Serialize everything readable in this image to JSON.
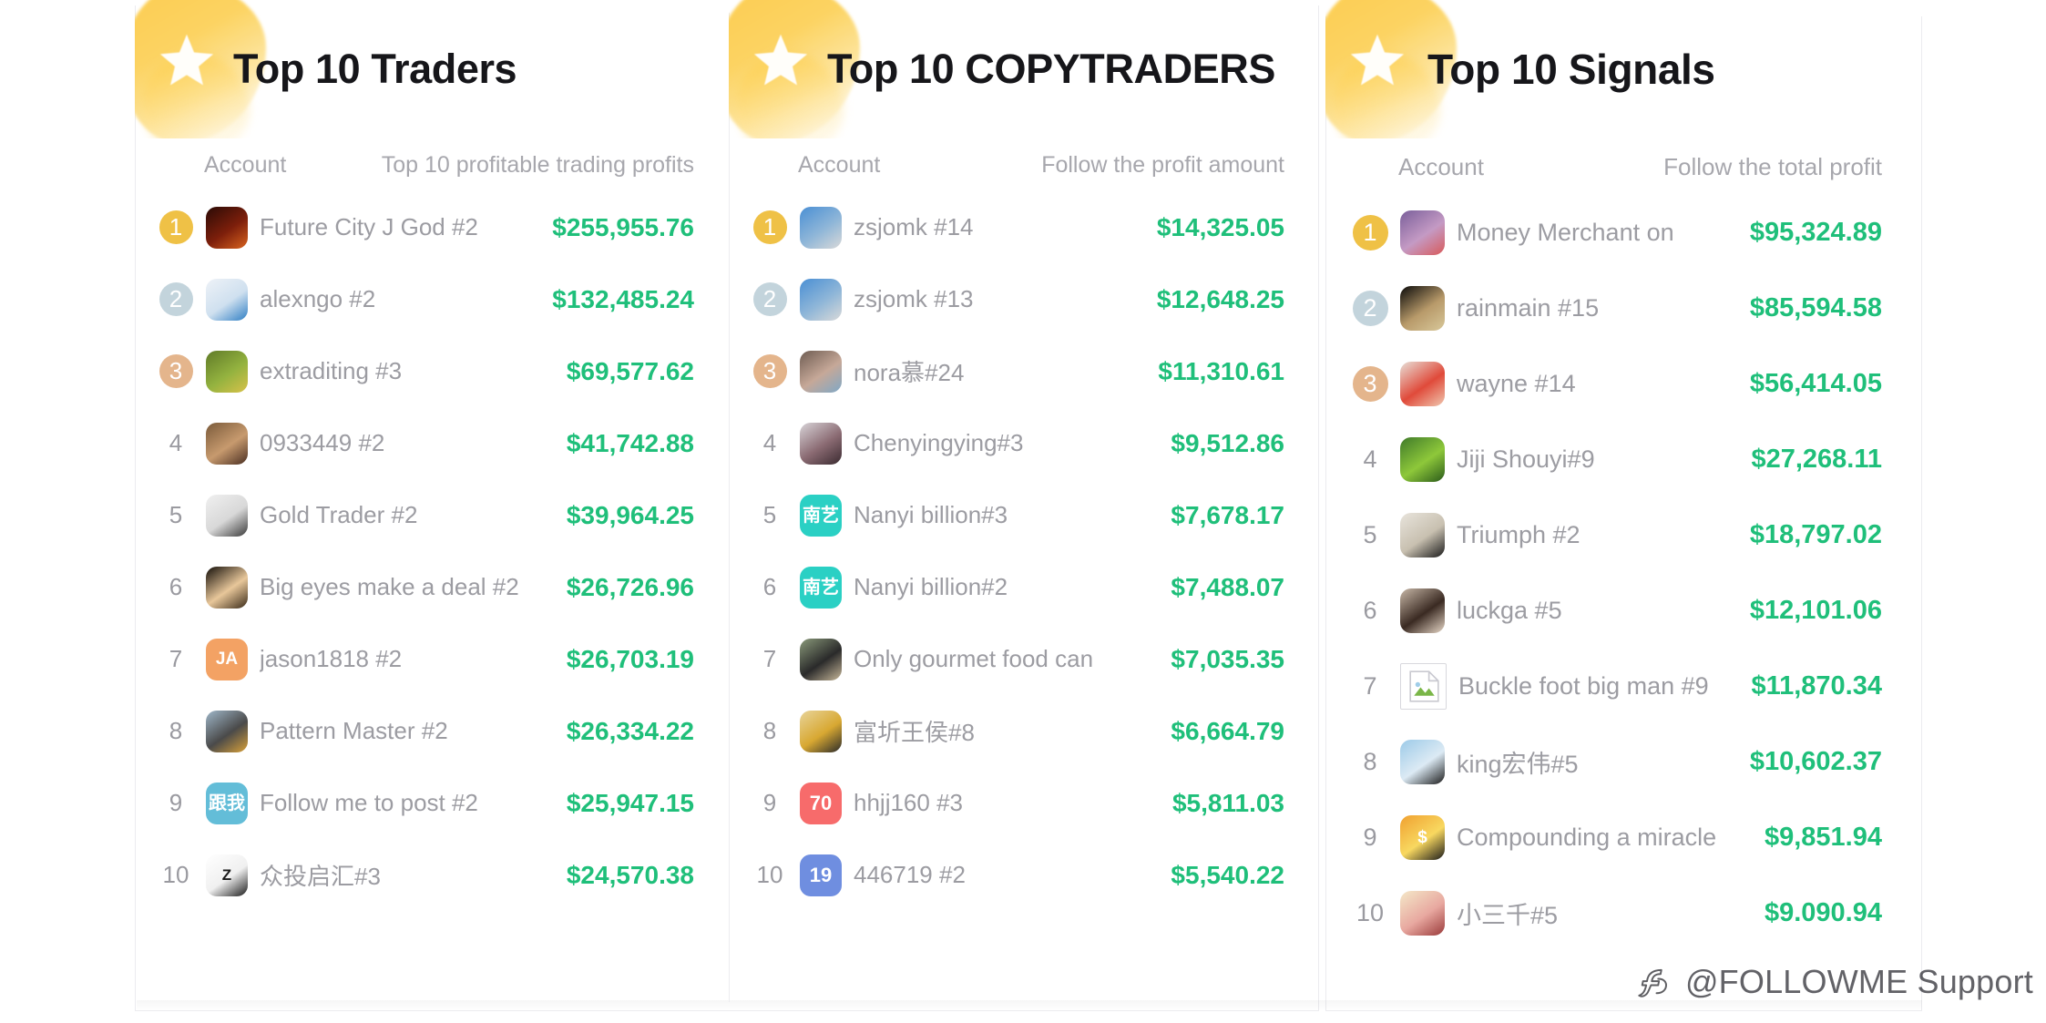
{
  "watermark": {
    "text": "@FOLLOWME Support",
    "logo_icon": "followme-logo-icon"
  },
  "colors": {
    "profit_green": "#1fbf7a",
    "rank_gold": "#efc146",
    "rank_silver": "#c3d4dc",
    "rank_bronze": "#e4b58c",
    "title_text": "#16161a",
    "muted_text": "#9c9ca2"
  },
  "columns": [
    {
      "title": "Top 10 Traders",
      "star_icon": "star-icon",
      "header": {
        "account": "Account",
        "value": "Top 10 profitable trading profits"
      },
      "rows": [
        {
          "rank": "1",
          "name": "Future City J God #2",
          "value": "$255,955.76",
          "avatar": {
            "type": "image",
            "colors": [
              "#2a0a06",
              "#7d1f0b",
              "#d9641f"
            ],
            "glyph": ""
          }
        },
        {
          "rank": "2",
          "name": "alexngo #2",
          "value": "$132,485.24",
          "avatar": {
            "type": "image",
            "colors": [
              "#eef2f7",
              "#cfe0ef",
              "#2f7fc4"
            ],
            "glyph": ""
          }
        },
        {
          "rank": "3",
          "name": "extraditing #3",
          "value": "$69,577.62",
          "avatar": {
            "type": "image",
            "colors": [
              "#5f7a28",
              "#93b23f",
              "#d8c24a"
            ],
            "glyph": ""
          }
        },
        {
          "rank": "4",
          "name": "0933449 #2",
          "value": "$41,742.88",
          "avatar": {
            "type": "image",
            "colors": [
              "#7a5a3a",
              "#c79a6e",
              "#4a2f22"
            ],
            "glyph": ""
          }
        },
        {
          "rank": "5",
          "name": "Gold Trader #2",
          "value": "$39,964.25",
          "avatar": {
            "type": "image",
            "colors": [
              "#f0f0f0",
              "#d8d8d8",
              "#3a3a3a"
            ],
            "glyph": ""
          }
        },
        {
          "rank": "6",
          "name": "Big eyes make a deal #2",
          "value": "$26,726.96",
          "avatar": {
            "type": "image",
            "colors": [
              "#120d08",
              "#e8c79a",
              "#3a2a18"
            ],
            "glyph": ""
          }
        },
        {
          "rank": "7",
          "name": "jason1818 #2",
          "value": "$26,703.19",
          "avatar": {
            "type": "initials",
            "colors": [
              "#f3a264",
              "#f3a264",
              "#f3a264"
            ],
            "glyph": "JA"
          }
        },
        {
          "rank": "8",
          "name": "Pattern Master #2",
          "value": "$26,334.22",
          "avatar": {
            "type": "image",
            "colors": [
              "#9fb7c9",
              "#4a4a4a",
              "#d9a13a"
            ],
            "glyph": ""
          }
        },
        {
          "rank": "9",
          "name": "Follow me to post #2",
          "value": "$25,947.15",
          "avatar": {
            "type": "text",
            "colors": [
              "#63bdd8",
              "#63bdd8",
              "#63bdd8"
            ],
            "glyph": "跟我"
          }
        },
        {
          "rank": "10",
          "name": "众投启汇#3",
          "value": "$24,570.38",
          "avatar": {
            "type": "logo",
            "colors": [
              "#ffffff",
              "#f0f0f0",
              "#1a1a1a"
            ],
            "glyph": "Z"
          }
        }
      ]
    },
    {
      "title": "Top 10 COPYTRADERS",
      "star_icon": "star-icon",
      "header": {
        "account": "Account",
        "value": "Follow the profit amount"
      },
      "rows": [
        {
          "rank": "1",
          "name": "zsjomk #14",
          "value": "$14,325.05",
          "avatar": {
            "type": "image",
            "colors": [
              "#4a8fd4",
              "#8fb6d8",
              "#d9d9d9"
            ],
            "glyph": ""
          }
        },
        {
          "rank": "2",
          "name": "zsjomk #13",
          "value": "$12,648.25",
          "avatar": {
            "type": "image",
            "colors": [
              "#4a8fd4",
              "#8fb6d8",
              "#d9d9d9"
            ],
            "glyph": ""
          }
        },
        {
          "rank": "3",
          "name": "nora慕#24",
          "value": "$11,310.61",
          "avatar": {
            "type": "image",
            "colors": [
              "#6e5c52",
              "#c6a898",
              "#7fa8c6"
            ],
            "glyph": ""
          }
        },
        {
          "rank": "4",
          "name": "Chenyingying#3",
          "value": "$9,512.86",
          "avatar": {
            "type": "image",
            "colors": [
              "#d8d4d8",
              "#8a6a72",
              "#3a2a30"
            ],
            "glyph": ""
          }
        },
        {
          "rank": "5",
          "name": "Nanyi billion#3",
          "value": "$7,678.17",
          "avatar": {
            "type": "text",
            "colors": [
              "#2ad0c4",
              "#2ad0c4",
              "#2ad0c4"
            ],
            "glyph": "南艺"
          }
        },
        {
          "rank": "6",
          "name": "Nanyi billion#2",
          "value": "$7,488.07",
          "avatar": {
            "type": "text",
            "colors": [
              "#2ad0c4",
              "#2ad0c4",
              "#2ad0c4"
            ],
            "glyph": "南艺"
          }
        },
        {
          "rank": "7",
          "name": "Only gourmet food can",
          "value": "$7,035.35",
          "avatar": {
            "type": "image",
            "colors": [
              "#8a9a7a",
              "#2a2a2a",
              "#c8b89a"
            ],
            "glyph": ""
          }
        },
        {
          "rank": "8",
          "name": "富圻王侯#8",
          "value": "$6,664.79",
          "avatar": {
            "type": "image",
            "colors": [
              "#e8d49a",
              "#d8a832",
              "#2a2a2a"
            ],
            "glyph": ""
          }
        },
        {
          "rank": "9",
          "name": "hhjj160 #3",
          "value": "$5,811.03",
          "avatar": {
            "type": "number",
            "colors": [
              "#f76b6b",
              "#f76b6b",
              "#f76b6b"
            ],
            "glyph": "70"
          }
        },
        {
          "rank": "10",
          "name": "446719 #2",
          "value": "$5,540.22",
          "avatar": {
            "type": "number",
            "colors": [
              "#6f8ee0",
              "#6f8ee0",
              "#6f8ee0"
            ],
            "glyph": "19"
          }
        }
      ]
    },
    {
      "title": "Top 10 Signals",
      "star_icon": "star-icon",
      "header": {
        "account": "Account",
        "value": "Follow the total profit"
      },
      "rows": [
        {
          "rank": "1",
          "name": "Money Merchant on",
          "value": "$95,324.89",
          "avatar": {
            "type": "image",
            "colors": [
              "#7a5f9a",
              "#c49ac4",
              "#d85a5a"
            ],
            "glyph": ""
          }
        },
        {
          "rank": "2",
          "name": "rainmain #15",
          "value": "$85,594.58",
          "avatar": {
            "type": "image",
            "colors": [
              "#0a0a0a",
              "#b89a6a",
              "#d8c89a"
            ],
            "glyph": ""
          }
        },
        {
          "rank": "3",
          "name": "wayne #14",
          "value": "$56,414.05",
          "avatar": {
            "type": "image",
            "colors": [
              "#e8e0d8",
              "#e04a3a",
              "#f0c8b0"
            ],
            "glyph": ""
          }
        },
        {
          "rank": "4",
          "name": "Jiji Shouyi#9",
          "value": "$27,268.11",
          "avatar": {
            "type": "image",
            "colors": [
              "#3f7a2a",
              "#8ec83a",
              "#2a5a1a"
            ],
            "glyph": ""
          }
        },
        {
          "rank": "5",
          "name": "Triumph #2",
          "value": "$18,797.02",
          "avatar": {
            "type": "image",
            "colors": [
              "#e8e4dc",
              "#c8c0b0",
              "#1a1a1a"
            ],
            "glyph": ""
          }
        },
        {
          "rank": "6",
          "name": "luckga #5",
          "value": "$12,101.06",
          "avatar": {
            "type": "image",
            "colors": [
              "#c8b8a8",
              "#3a2a22",
              "#e8d8c8"
            ],
            "glyph": ""
          }
        },
        {
          "rank": "7",
          "name": "Buckle foot big man #9",
          "value": "$11,870.34",
          "avatar": {
            "type": "broken",
            "colors": [
              "#ffffff",
              "#dcdce0",
              "#7ab648"
            ],
            "glyph": ""
          }
        },
        {
          "rank": "8",
          "name": "king宏伟#5",
          "value": "$10,602.37",
          "avatar": {
            "type": "image",
            "colors": [
              "#9ccae8",
              "#dceaf4",
              "#1a1a1a"
            ],
            "glyph": ""
          }
        },
        {
          "rank": "9",
          "name": "Compounding a miracle",
          "value": "$9,851.94",
          "avatar": {
            "type": "image",
            "colors": [
              "#f0a030",
              "#f8d860",
              "#1a1a1a"
            ],
            "glyph": "$"
          }
        },
        {
          "rank": "10",
          "name": "小三千#5",
          "value": "$9.090.94",
          "avatar": {
            "type": "image",
            "colors": [
              "#f4e8c8",
              "#e8a8a0",
              "#9a3a3a"
            ],
            "glyph": ""
          }
        }
      ]
    }
  ]
}
